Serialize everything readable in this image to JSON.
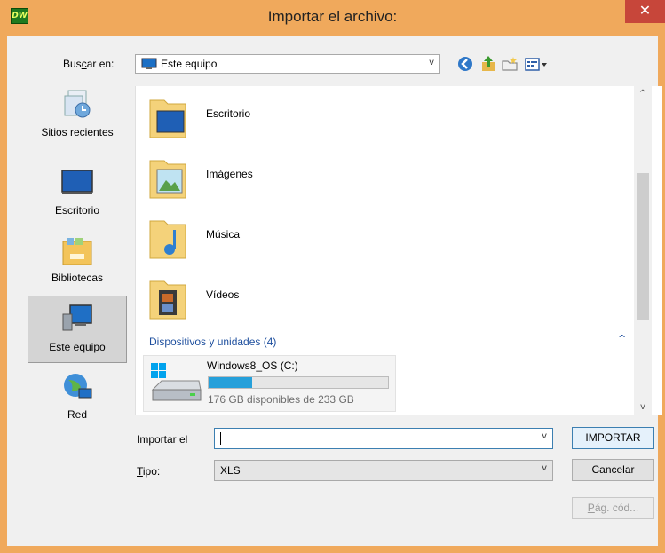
{
  "window": {
    "title": "Importar el archivo:",
    "app_icon_text": "DW",
    "close_glyph": "✕",
    "accent": "#f0a95c"
  },
  "lookin": {
    "label_pre": "Bus",
    "label_ul": "c",
    "label_post": "ar en:",
    "value": "Este equipo",
    "icon": "computer-icon"
  },
  "toolbar": {
    "items": [
      "back-icon",
      "up-folder-icon",
      "new-folder-icon",
      "view-menu-icon"
    ]
  },
  "places": {
    "items": [
      {
        "label": "Sitios recientes",
        "icon": "recent-places-icon"
      },
      {
        "label": "Escritorio",
        "icon": "desktop-icon"
      },
      {
        "label": "Bibliotecas",
        "icon": "libraries-icon"
      },
      {
        "label": "Este equipo",
        "icon": "computer-icon",
        "selected": true
      },
      {
        "label": "Red",
        "icon": "network-icon"
      }
    ]
  },
  "files": {
    "items": [
      {
        "name": "Escritorio",
        "icon": "desktop-folder-icon"
      },
      {
        "name": "Imágenes",
        "icon": "pictures-folder-icon"
      },
      {
        "name": "Música",
        "icon": "music-folder-icon"
      },
      {
        "name": "Vídeos",
        "icon": "videos-folder-icon"
      }
    ],
    "section_label": "Dispositivos y unidades (4)",
    "section_caret": "^",
    "drive": {
      "name": "Windows8_OS (C:)",
      "free_text": "176 GB disponibles de 233 GB",
      "used_fraction": 0.245,
      "icon": "hard-drive-icon"
    }
  },
  "scroll": {
    "up": "^",
    "down": "v"
  },
  "form": {
    "filename_label": "Importar el",
    "filename_value": "",
    "type_label_ul": "T",
    "type_label_post": "ipo:",
    "type_value": "XLS",
    "dropdown_glyph": "v"
  },
  "buttons": {
    "import": "IMPORTAR",
    "cancel": "Cancelar",
    "codepage_ul": "P",
    "codepage_post": "ág. cód..."
  }
}
